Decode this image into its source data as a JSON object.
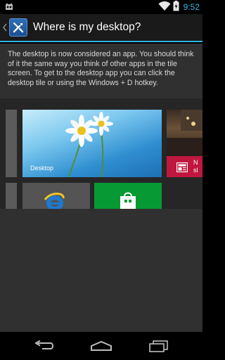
{
  "status_bar": {
    "time": "9:52",
    "icons": [
      "android-debug-icon",
      "wifi-icon",
      "battery-charging-icon"
    ]
  },
  "action_bar": {
    "up_icon": "chevron-left-icon",
    "app_icon": "tools-icon",
    "title": "Where is my desktop?"
  },
  "content": {
    "intro": "The desktop is now considered an app. You should think of it the same way you think of other apps in the tile screen. To get to the desktop app you can click the desktop tile or using the Windows + D hotkey.",
    "tiles": {
      "desktop_label": "Desktop",
      "news_label_partial": "N\nsl"
    }
  },
  "nav_bar": {
    "icons": [
      "back-icon",
      "home-icon",
      "recent-apps-icon"
    ]
  },
  "colors": {
    "accent": "#33b5e5",
    "background": "#303030",
    "news_tile": "#c0173f",
    "store_tile": "#079a34"
  }
}
